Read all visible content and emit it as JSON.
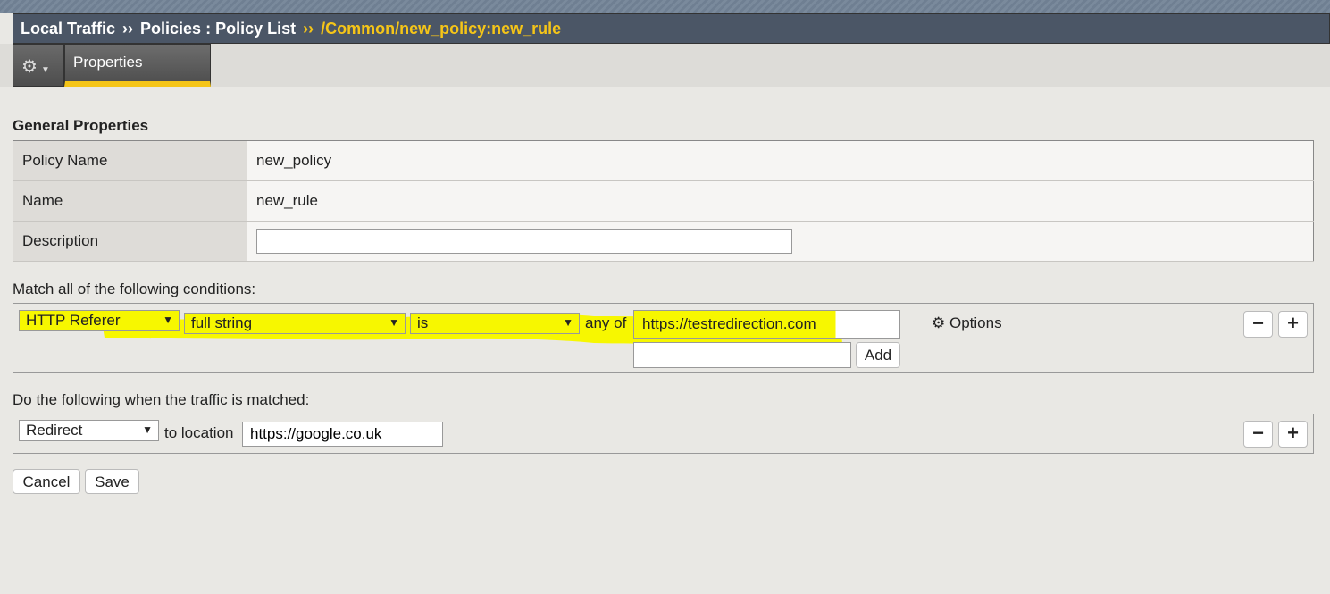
{
  "breadcrumb": {
    "part1": "Local Traffic",
    "sep": "››",
    "part2": "Policies : Policy List",
    "current": "/Common/new_policy:new_rule"
  },
  "tabs": {
    "properties": "Properties"
  },
  "general": {
    "heading": "General Properties",
    "rows": [
      {
        "label": "Policy Name",
        "value": "new_policy"
      },
      {
        "label": "Name",
        "value": "new_rule"
      },
      {
        "label": "Description",
        "value": ""
      }
    ]
  },
  "conditions": {
    "label": "Match all of the following conditions:",
    "operand": "HTTP Referer",
    "selector": "full string",
    "operator": "is",
    "any_of": "any of",
    "values": [
      "https://testredirection.com"
    ],
    "new_value": "",
    "add": "Add",
    "options": "Options"
  },
  "actions": {
    "label": "Do the following when the traffic is matched:",
    "action": "Redirect",
    "to_location": "to location",
    "location": "https://google.co.uk"
  },
  "buttons": {
    "cancel": "Cancel",
    "save": "Save",
    "minus": "−",
    "plus": "+"
  },
  "highlight_color": "#f7f700"
}
